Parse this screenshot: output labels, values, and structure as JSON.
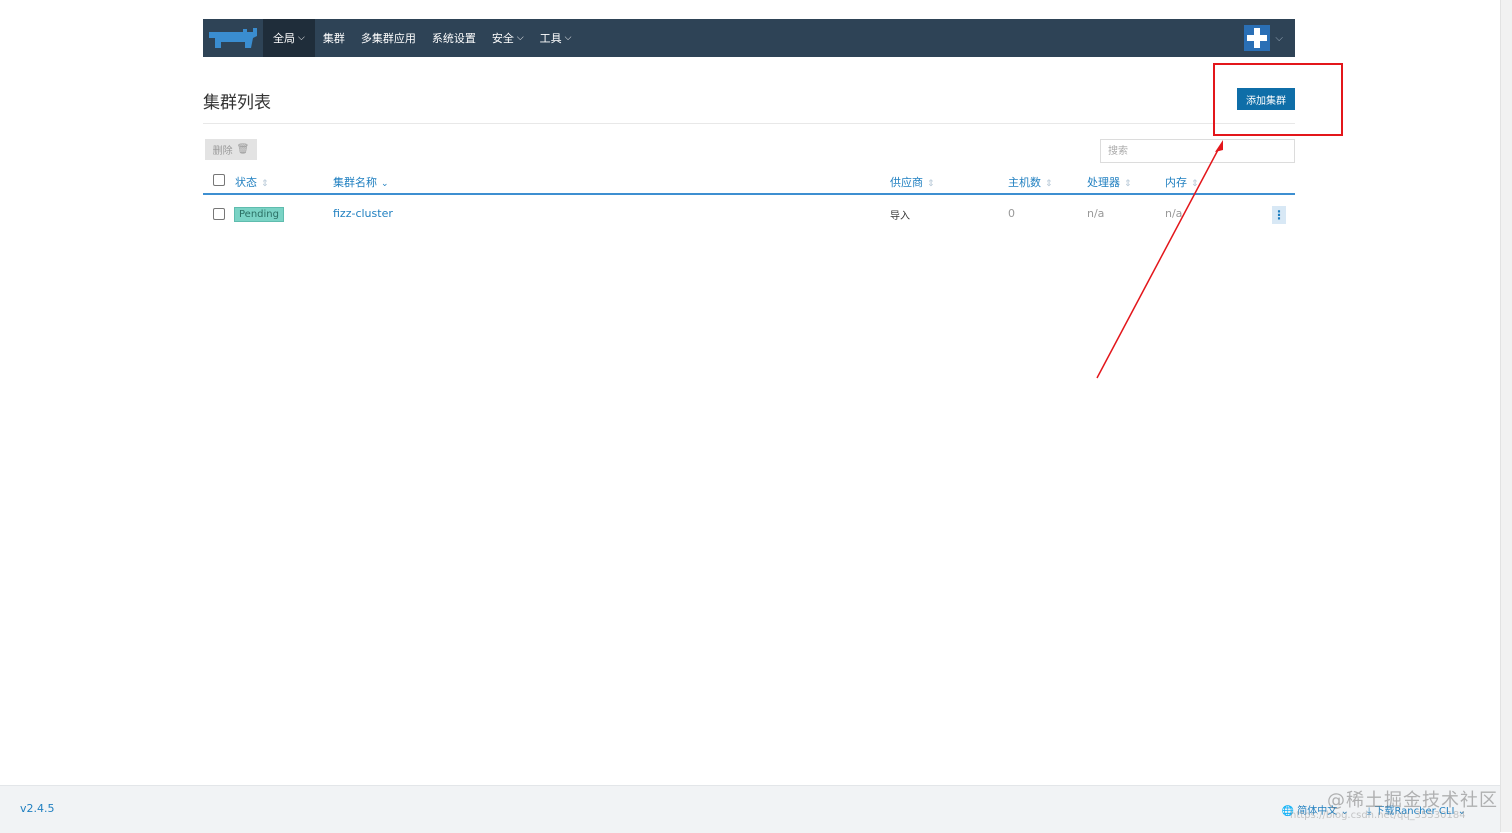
{
  "nav": {
    "items": [
      {
        "label": "全局",
        "dropdown": true
      },
      {
        "label": "集群",
        "dropdown": false
      },
      {
        "label": "多集群应用",
        "dropdown": false
      },
      {
        "label": "系统设置",
        "dropdown": false
      },
      {
        "label": "安全",
        "dropdown": true
      },
      {
        "label": "工具",
        "dropdown": true
      }
    ]
  },
  "page": {
    "title": "集群列表",
    "add_button": "添加集群",
    "delete_button": "删除",
    "search_placeholder": "搜索"
  },
  "table": {
    "columns": [
      "状态",
      "集群名称",
      "供应商",
      "主机数",
      "处理器",
      "内存"
    ],
    "rows": [
      {
        "status": "Pending",
        "name": "fizz-cluster",
        "provider": "导入",
        "hosts": "0",
        "cpu": "n/a",
        "memory": "n/a"
      }
    ]
  },
  "footer": {
    "version": "v2.4.5",
    "language": "简体中文",
    "download": "下载Rancher CLI"
  },
  "watermark": {
    "text": "@稀土掘金技术社区",
    "url": "https://blog.csdn.net/qq_35530184"
  },
  "colors": {
    "nav_bg": "#2e4356",
    "accent": "#0f6ea8",
    "highlight": "#e3161b",
    "pending_badge": "#7ad3c5"
  }
}
